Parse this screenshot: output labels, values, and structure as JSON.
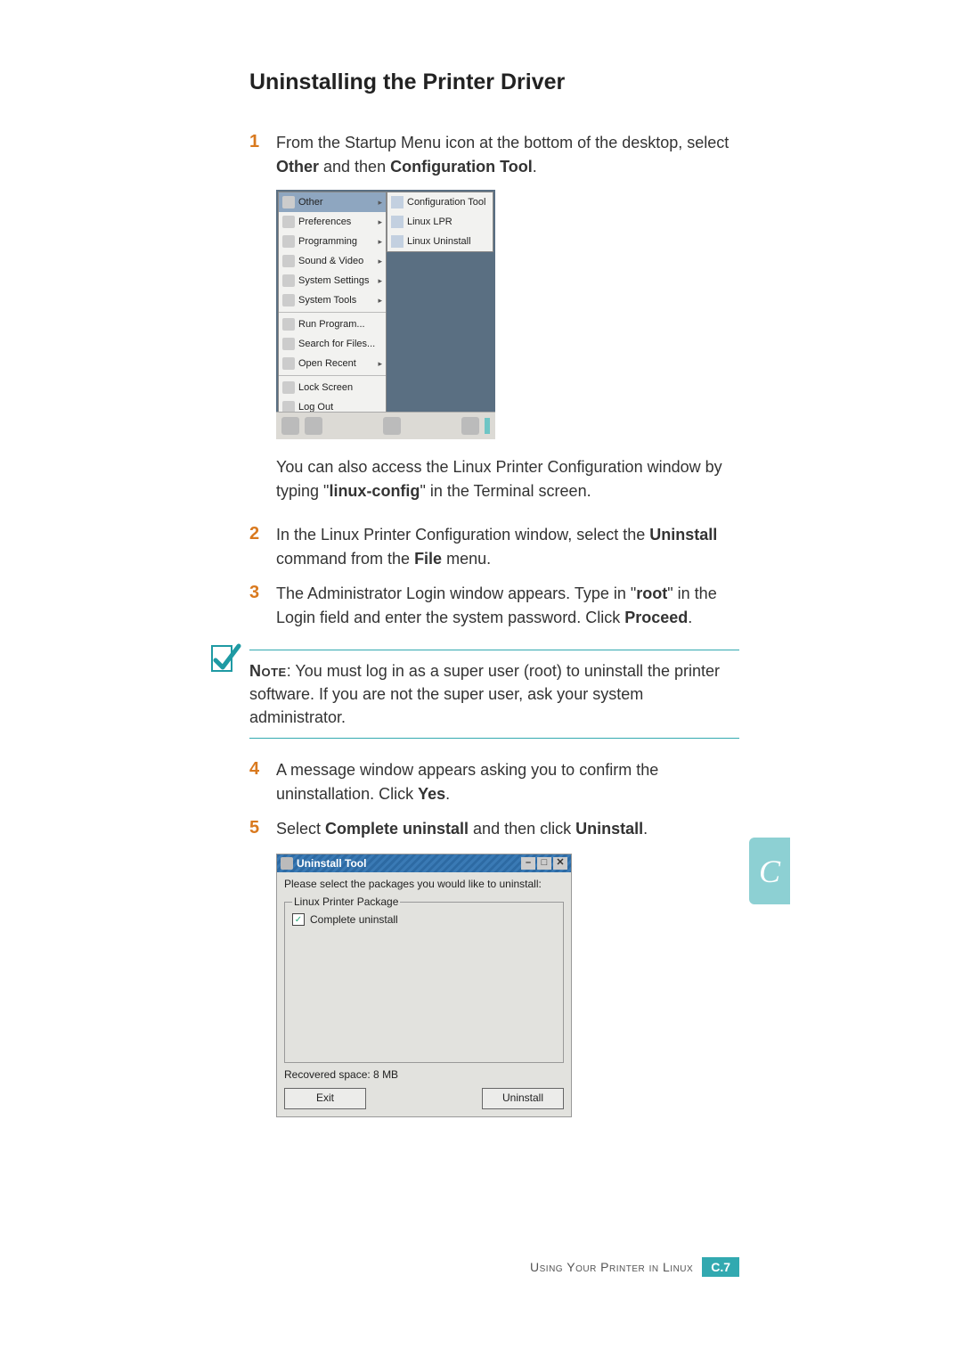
{
  "heading": "Uninstalling the Printer Driver",
  "steps": {
    "s1": {
      "num": "1",
      "text_a": "From the Startup Menu icon at the bottom of the desktop, select ",
      "b1": "Other",
      "text_b": " and then ",
      "b2": "Configuration Tool",
      "text_c": "."
    },
    "s1_follow_a": "You can also access the Linux Printer Configuration window by typing \"",
    "s1_follow_b": "linux-config",
    "s1_follow_c": "\" in the Terminal screen.",
    "s2": {
      "num": "2",
      "text_a": "In the Linux Printer Configuration window, select the ",
      "b1": "Uninstall",
      "text_b": " command from the ",
      "b2": "File",
      "text_c": " menu."
    },
    "s3": {
      "num": "3",
      "text_a": "The Administrator Login window appears. Type in \"",
      "b1": "root",
      "text_b": "\" in the Login field and enter the system password. Click ",
      "b2": "Proceed",
      "text_c": "."
    },
    "s4": {
      "num": "4",
      "text_a": "A message window appears asking you to confirm the uninstallation. Click ",
      "b1": "Yes",
      "text_b": "."
    },
    "s5": {
      "num": "5",
      "text_a": "Select ",
      "b1": "Complete uninstall",
      "text_b": " and then click ",
      "b2": "Uninstall",
      "text_c": "."
    }
  },
  "note": {
    "label": "Note",
    "text": ": You must log in as a super user (root) to uninstall the printer software. If you are not the super user, ask your system administrator."
  },
  "menu": {
    "items": [
      "Other",
      "Preferences",
      "Programming",
      "Sound & Video",
      "System Settings",
      "System Tools"
    ],
    "items2": [
      "Run Program...",
      "Search for Files...",
      "Open Recent"
    ],
    "items3": [
      "Lock Screen",
      "Log Out"
    ],
    "sub": [
      "Configuration Tool",
      "Linux LPR",
      "Linux Uninstall"
    ]
  },
  "uninstall": {
    "title": "Uninstall Tool",
    "prompt": "Please select the packages you would like to uninstall:",
    "group": "Linux Printer Package",
    "checkbox": "Complete uninstall",
    "recovered": "Recovered space:  8 MB",
    "exit": "Exit",
    "uninstall_btn": "Uninstall"
  },
  "footer": {
    "text": "Using Your Printer in Linux",
    "badge_letter": "C.",
    "badge_num": "7"
  },
  "tab": "C"
}
